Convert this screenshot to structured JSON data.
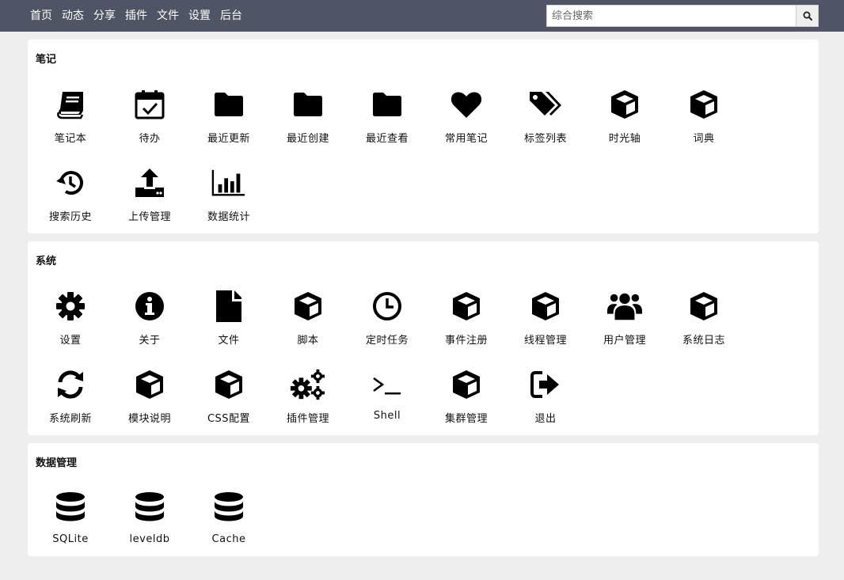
{
  "nav": {
    "items": [
      "首页",
      "动态",
      "分享",
      "插件",
      "文件",
      "设置",
      "后台"
    ]
  },
  "search": {
    "placeholder": "综合搜索",
    "value": "",
    "icon": "search-icon"
  },
  "sections": [
    {
      "title": "笔记",
      "items": [
        {
          "label": "笔记本",
          "icon": "book"
        },
        {
          "label": "待办",
          "icon": "calendar-check"
        },
        {
          "label": "最近更新",
          "icon": "folder"
        },
        {
          "label": "最近创建",
          "icon": "folder"
        },
        {
          "label": "最近查看",
          "icon": "folder"
        },
        {
          "label": "常用笔记",
          "icon": "heart"
        },
        {
          "label": "标签列表",
          "icon": "tags"
        },
        {
          "label": "时光轴",
          "icon": "cube"
        },
        {
          "label": "词典",
          "icon": "cube"
        },
        {
          "label": "搜索历史",
          "icon": "history"
        },
        {
          "label": "上传管理",
          "icon": "upload"
        },
        {
          "label": "数据统计",
          "icon": "bar-chart"
        }
      ]
    },
    {
      "title": "系统",
      "items": [
        {
          "label": "设置",
          "icon": "gear"
        },
        {
          "label": "关于",
          "icon": "info"
        },
        {
          "label": "文件",
          "icon": "file"
        },
        {
          "label": "脚本",
          "icon": "cube"
        },
        {
          "label": "定时任务",
          "icon": "clock"
        },
        {
          "label": "事件注册",
          "icon": "cube"
        },
        {
          "label": "线程管理",
          "icon": "cube"
        },
        {
          "label": "用户管理",
          "icon": "users"
        },
        {
          "label": "系统日志",
          "icon": "cube"
        },
        {
          "label": "系统刷新",
          "icon": "refresh"
        },
        {
          "label": "模块说明",
          "icon": "cube"
        },
        {
          "label": "CSS配置",
          "icon": "cube"
        },
        {
          "label": "插件管理",
          "icon": "gears"
        },
        {
          "label": "Shell",
          "icon": "terminal"
        },
        {
          "label": "集群管理",
          "icon": "cube"
        },
        {
          "label": "退出",
          "icon": "sign-out"
        }
      ]
    },
    {
      "title": "数据管理",
      "items": [
        {
          "label": "SQLite",
          "icon": "database"
        },
        {
          "label": "leveldb",
          "icon": "database"
        },
        {
          "label": "Cache",
          "icon": "database"
        }
      ]
    }
  ],
  "colors": {
    "topbar": "#4f5564",
    "background": "#eeeeee",
    "card": "#ffffff"
  }
}
